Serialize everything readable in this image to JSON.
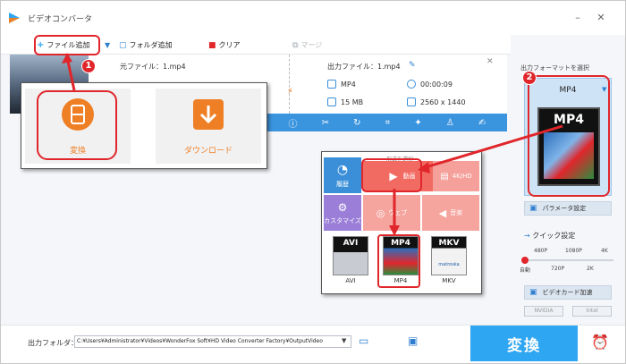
{
  "app": {
    "title": "ビデオコンバータ"
  },
  "toolbar": {
    "add_file": "ファイル追加",
    "add_folder": "フォルダ追加",
    "clear": "クリア",
    "merge": "マージ"
  },
  "file": {
    "source": "元ファイル：1.mp4",
    "output": "出力ファイル：1.mp4",
    "format": "MP4",
    "duration": "00:00:09",
    "size": "15 MB",
    "resolution": "2560 x 1440"
  },
  "popup1": {
    "convert": "変換",
    "download": "ダウンロード"
  },
  "right_panel": {
    "title": "出力フォーマットを選択",
    "selected_format": "MP4",
    "format_icon_text": "MP4",
    "param_button": "パラメータ設定",
    "quick_settings": "クイック設定",
    "ticks_top": [
      "480P",
      "1080P",
      "4K"
    ],
    "ticks_bottom": [
      "自動",
      "720P",
      "2K"
    ],
    "gpu_button": "ビデオカード加速",
    "chips": [
      "NVIDIA",
      "Intel"
    ]
  },
  "popup2": {
    "header": "形式を選択",
    "categories": [
      "履歴",
      "動画",
      "4K/HD",
      "カスタマイズ",
      "ウェブ",
      "音楽"
    ],
    "formats": [
      "AVI",
      "MP4",
      "MKV"
    ],
    "mkv_brand": "matroska"
  },
  "bottom": {
    "output_folder_label": "出力フォルダ：",
    "output_path": "C:¥Users¥Administrator¥Videos¥WonderFox Soft¥HD Video Converter Factory¥OutputVideo",
    "convert_button": "変換"
  },
  "annotations": {
    "badge1": "1",
    "badge2": "2"
  },
  "colors": {
    "accent": "#2fa6f2",
    "annotation": "#e0262b",
    "orange": "#ef7f25",
    "blue_bar": "#3b94de"
  }
}
